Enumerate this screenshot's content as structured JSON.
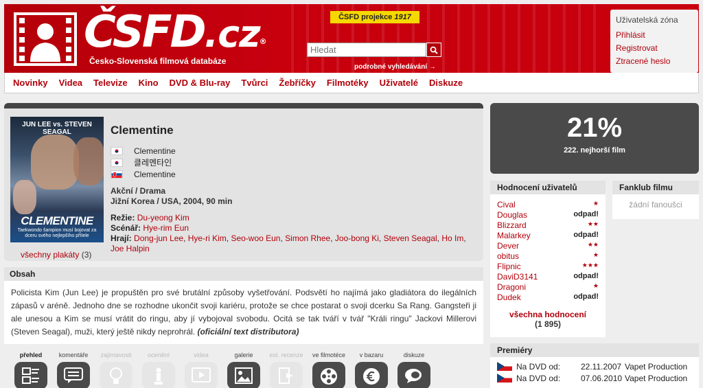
{
  "header": {
    "brand": "ČSFD",
    "brand_tld": ".cz",
    "reg_mark": "®",
    "tagline": "Česko-Slovenská filmová databáze",
    "promo_prefix": "ČSFD projekce",
    "promo_film": "1917",
    "search_placeholder": "Hledat",
    "advanced_search": "podrobné vyhledávání →"
  },
  "userzone": {
    "title": "Uživatelská zóna",
    "login": "Přihlásit",
    "register": "Registrovat",
    "lost_password": "Ztracené heslo"
  },
  "nav": [
    "Novinky",
    "Videa",
    "Televize",
    "Kino",
    "DVD & Blu-ray",
    "Tvůrci",
    "Žebříčky",
    "Filmotéky",
    "Uživatelé",
    "Diskuze"
  ],
  "movie": {
    "title": "Clementine",
    "alt_names": [
      {
        "flag": "kr",
        "name": "Clementine"
      },
      {
        "flag": "kr",
        "name": "클레멘타인"
      },
      {
        "flag": "sk",
        "name": "Clementine"
      }
    ],
    "genre": "Akční / Drama",
    "origin": "Jižní Korea / USA, 2004, 90 min",
    "director_label": "Režie:",
    "director": "Du-yeong Kim",
    "writer_label": "Scénář:",
    "writer": "Hye-rim Eun",
    "cast_label": "Hrají:",
    "cast": [
      "Dong-jun Lee",
      "Hye-ri Kim",
      "Seo-woo Eun",
      "Simon Rhee",
      "Joo-bong Ki",
      "Steven Seagal",
      "Ho Im",
      "Joe Halpin"
    ],
    "all_posters": "všechny plakáty",
    "posters_count": "(3)",
    "poster": {
      "top": "JUN LEE vs. STEVEN SEAGAL",
      "title": "CLEMENTINE",
      "sub": "Taekwondo šampion musí bojovat za dceru svého nejlepšího přítele"
    }
  },
  "plot": {
    "heading": "Obsah",
    "text": "Policista Kim (Jun Lee) je propuštěn pro své brutální způsoby vyšetřování. Podsvětí ho najímá jako gladiátora do ilegálních zápasů v aréně. Jednoho dne se rozhodne ukončit svoji kariéru, protože se chce postarat o svoji dcerku Sa Rang. Gangsteři ji ale unesou a Kim se musí vrátit do ringu, aby jí vybojoval svobodu. Ocitá se tak tváří v tvář \"Králi ringu\" Jackovi Millerovi (Steven Seagal), muži, který ještě nikdy neprohrál.",
    "source": "(oficiální text distributora)"
  },
  "tabs": [
    {
      "label": "přehled",
      "state": "active",
      "icon": "overview-icon"
    },
    {
      "label": "komentáře",
      "state": "on",
      "icon": "comments-icon"
    },
    {
      "label": "zajímavosti",
      "state": "off",
      "icon": "trivia-icon"
    },
    {
      "label": "ocenění",
      "state": "off",
      "icon": "awards-icon"
    },
    {
      "label": "videa",
      "state": "off",
      "icon": "video-icon"
    },
    {
      "label": "galerie",
      "state": "on",
      "icon": "gallery-icon"
    },
    {
      "label": "ext. recenze",
      "state": "off",
      "icon": "reviews-icon"
    },
    {
      "label": "ve filmotéce",
      "state": "on",
      "icon": "filmotheque-icon"
    },
    {
      "label": "v bazaru",
      "state": "on",
      "icon": "bazaar-icon"
    },
    {
      "label": "diskuze",
      "state": "on",
      "icon": "discussion-icon"
    }
  ],
  "rating": {
    "percent": "21%",
    "rank": "222. nejhorší film"
  },
  "user_ratings": {
    "heading": "Hodnocení uživatelů",
    "items": [
      {
        "user": "Cival",
        "value": "★",
        "type": "stars"
      },
      {
        "user": "Douglas",
        "value": "odpad!",
        "type": "text"
      },
      {
        "user": "Blizzard",
        "value": "★★",
        "type": "stars"
      },
      {
        "user": "Malarkey",
        "value": "odpad!",
        "type": "text"
      },
      {
        "user": "Dever",
        "value": "★★",
        "type": "stars"
      },
      {
        "user": "obitus",
        "value": "★",
        "type": "stars"
      },
      {
        "user": "Flipnic",
        "value": "★★★",
        "type": "stars"
      },
      {
        "user": "DaviD3141",
        "value": "odpad!",
        "type": "text"
      },
      {
        "user": "Dragoni",
        "value": "★",
        "type": "stars"
      },
      {
        "user": "Dudek",
        "value": "odpad!",
        "type": "text"
      }
    ],
    "all_label": "všechna hodnocení",
    "all_count": "(1 895)"
  },
  "fanclub": {
    "heading": "Fanklub filmu",
    "empty": "žádní fanoušci"
  },
  "premieres": {
    "heading": "Premiéry",
    "items": [
      {
        "flag": "cz",
        "medium": "Na DVD od:",
        "date": "22.11.2007",
        "distributor": "Vapet Production"
      },
      {
        "flag": "cz",
        "medium": "Na DVD od:",
        "date": "07.06.2010",
        "distributor": "Vapet Production"
      }
    ]
  },
  "colors": {
    "brand_red": "#c8000e",
    "link_red": "#b0000a",
    "promo_yellow": "#f5d800",
    "dark_panel": "#4a4a4a"
  }
}
